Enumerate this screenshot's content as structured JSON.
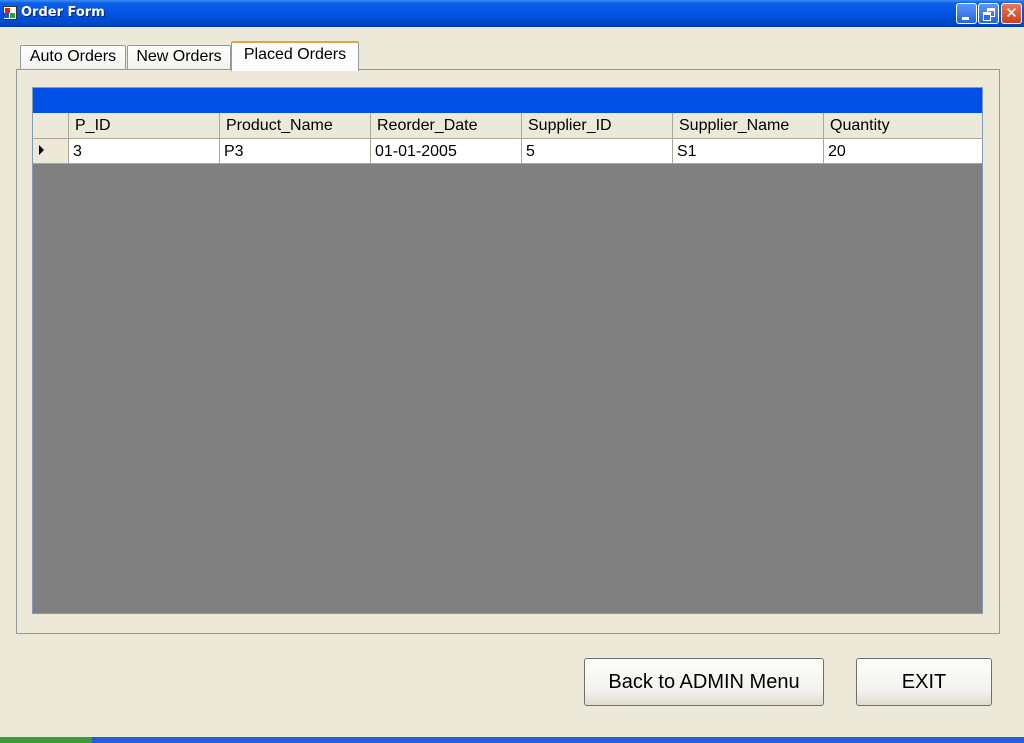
{
  "window": {
    "title": "Order Form"
  },
  "tabs": [
    {
      "label": "Auto Orders",
      "active": false
    },
    {
      "label": "New Orders",
      "active": false
    },
    {
      "label": "Placed Orders",
      "active": true
    }
  ],
  "grid": {
    "columns": [
      "P_ID",
      "Product_Name",
      "Reorder_Date",
      "Supplier_ID",
      "Supplier_Name",
      "Quantity"
    ],
    "rows": [
      [
        "3",
        "P3",
        "01-01-2005",
        "5",
        "S1",
        "20"
      ]
    ],
    "caption_color": "#0050e6",
    "empty_area_color": "#808080"
  },
  "buttons": {
    "back_label": "Back to ADMIN Menu",
    "exit_label": "EXIT"
  },
  "icons": {
    "app": "app-window-icon",
    "minimize": "minimize-icon",
    "maximize": "restore-icon",
    "close": "close-icon",
    "row_indicator": "current-row-arrow-icon"
  }
}
